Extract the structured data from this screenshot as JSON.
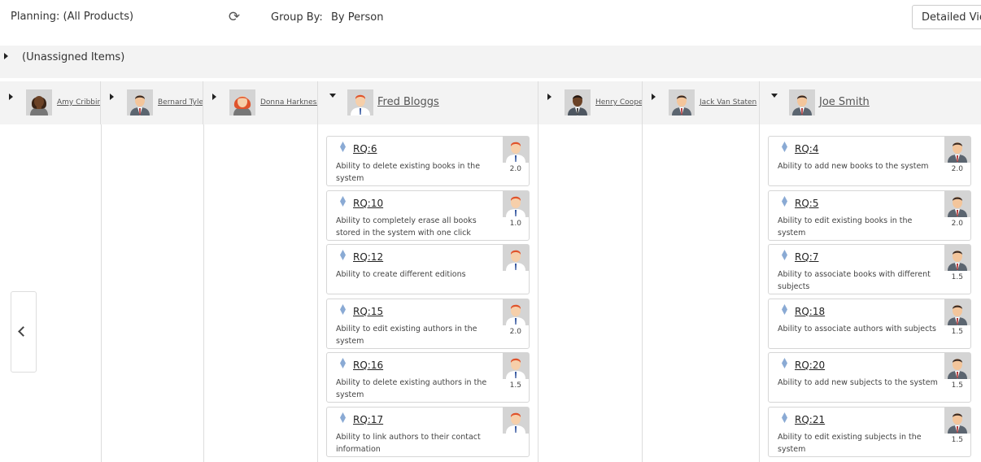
{
  "toolbar": {
    "title": "Planning: (All Products)",
    "refresh_icon": "refresh-icon",
    "group_by_label": "Group By:",
    "group_by_value": "By Person",
    "view_button": "Detailed View"
  },
  "unassigned": {
    "label": "(Unassigned Items)"
  },
  "people": [
    {
      "name": "Amy Cribbins",
      "avatar": "female-dark-avatar",
      "expanded": false
    },
    {
      "name": "Bernard Tyler",
      "avatar": "male-dark-avatar",
      "expanded": false
    },
    {
      "name": "Donna Harkness",
      "avatar": "female-red-avatar",
      "expanded": false
    },
    {
      "name": "Fred Bloggs",
      "avatar": "male-red-avatar",
      "expanded": true
    },
    {
      "name": "Henry Cooper",
      "avatar": "male-brown-avatar",
      "expanded": false
    },
    {
      "name": "Jack Van Staten",
      "avatar": "male-dark-avatar",
      "expanded": false
    },
    {
      "name": "Joe Smith",
      "avatar": "male-dark-avatar",
      "expanded": true
    }
  ],
  "fred_cards": [
    {
      "id": "RQ:6",
      "desc": "Ability to delete existing books in the system",
      "estimate": "2.0"
    },
    {
      "id": "RQ:10",
      "desc": "Ability to completely erase all books stored in the system with one click",
      "estimate": "1.0"
    },
    {
      "id": "RQ:12",
      "desc": "Ability to create different editions",
      "estimate": ""
    },
    {
      "id": "RQ:15",
      "desc": "Ability to edit existing authors in the system",
      "estimate": "2.0"
    },
    {
      "id": "RQ:16",
      "desc": "Ability to delete existing authors in the system",
      "estimate": "1.5"
    },
    {
      "id": "RQ:17",
      "desc": "Ability to link authors to their contact information",
      "estimate": ""
    }
  ],
  "joe_cards": [
    {
      "id": "RQ:4",
      "desc": "Ability to add new books to the system",
      "estimate": "2.0"
    },
    {
      "id": "RQ:5",
      "desc": "Ability to edit existing books in the system",
      "estimate": "2.0"
    },
    {
      "id": "RQ:7",
      "desc": "Ability to associate books with different subjects",
      "estimate": "1.5"
    },
    {
      "id": "RQ:18",
      "desc": "Ability to associate authors with subjects",
      "estimate": "1.5"
    },
    {
      "id": "RQ:20",
      "desc": "Ability to add new subjects to the system",
      "estimate": "1.5"
    },
    {
      "id": "RQ:21",
      "desc": "Ability to edit existing subjects in the system",
      "estimate": "1.5"
    }
  ],
  "colors": {
    "requirement_diamond": "#8aaad4",
    "band_bg": "#f3f3f3",
    "avatar_bg": "#d4d4d4"
  }
}
